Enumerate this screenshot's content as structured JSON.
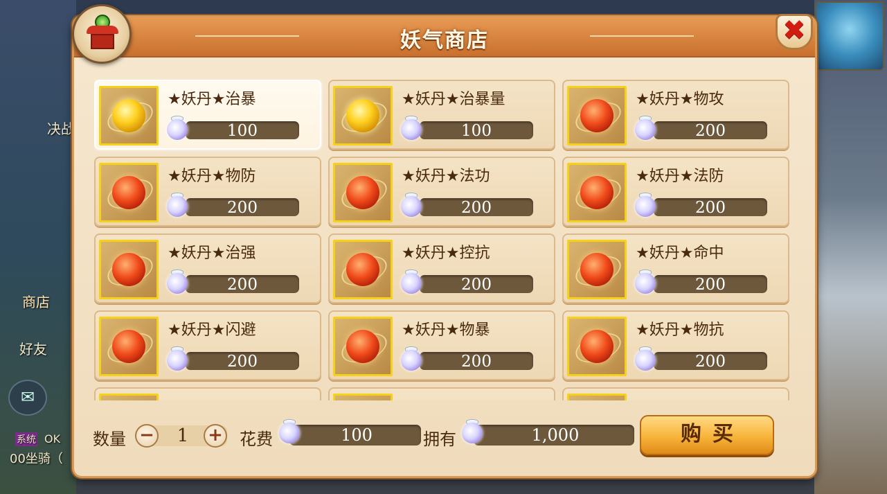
{
  "background": {
    "labels": [
      "决战",
      "商店",
      "好友",
      "系统",
      "OK",
      "00坐骑（"
    ]
  },
  "shop": {
    "title": "妖气商店",
    "close_symbol": "✖",
    "items": [
      {
        "name": "★妖丹★治暴",
        "price": "100",
        "orb": "gold",
        "selected": true
      },
      {
        "name": "★妖丹★治暴量",
        "price": "100",
        "orb": "gold",
        "selected": false
      },
      {
        "name": "★妖丹★物攻",
        "price": "200",
        "orb": "red",
        "selected": false
      },
      {
        "name": "★妖丹★物防",
        "price": "200",
        "orb": "red",
        "selected": false
      },
      {
        "name": "★妖丹★法功",
        "price": "200",
        "orb": "red",
        "selected": false
      },
      {
        "name": "★妖丹★法防",
        "price": "200",
        "orb": "red",
        "selected": false
      },
      {
        "name": "★妖丹★治强",
        "price": "200",
        "orb": "red",
        "selected": false
      },
      {
        "name": "★妖丹★控抗",
        "price": "200",
        "orb": "red",
        "selected": false
      },
      {
        "name": "★妖丹★命中",
        "price": "200",
        "orb": "red",
        "selected": false
      },
      {
        "name": "★妖丹★闪避",
        "price": "200",
        "orb": "red",
        "selected": false
      },
      {
        "name": "★妖丹★物暴",
        "price": "200",
        "orb": "red",
        "selected": false
      },
      {
        "name": "★妖丹★物抗",
        "price": "200",
        "orb": "red",
        "selected": false
      },
      {
        "name": "",
        "price": "",
        "orb": "red",
        "selected": false
      },
      {
        "name": "",
        "price": "",
        "orb": "gold",
        "selected": false
      },
      {
        "name": "",
        "price": "",
        "orb": "red",
        "selected": false
      }
    ],
    "quantity_label": "数量",
    "quantity_value": "1",
    "minus_symbol": "−",
    "plus_symbol": "+",
    "cost_label": "花费",
    "cost_value": "100",
    "owned_label": "拥有",
    "owned_value": "1,000",
    "buy_label": "购买"
  }
}
